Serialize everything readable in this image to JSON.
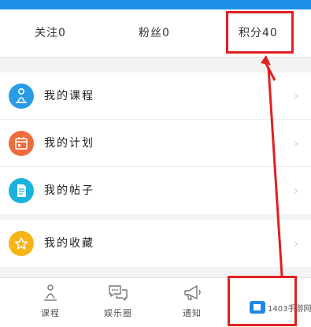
{
  "stats": {
    "follow": "关注0",
    "fans": "粉丝0",
    "points": "积分40"
  },
  "menu": {
    "items": [
      {
        "label": "我的课程",
        "icon": "meditation-icon",
        "color": "#2a9be5"
      },
      {
        "label": "我的计划",
        "icon": "calendar-icon",
        "color": "#ef6c3c"
      },
      {
        "label": "我的帖子",
        "icon": "document-icon",
        "color": "#19b3dd"
      },
      {
        "label": "我的收藏",
        "icon": "star-icon",
        "color": "#f7b417"
      }
    ]
  },
  "tabbar": {
    "tabs": [
      {
        "label": "课程",
        "icon": "meditation-tab-icon"
      },
      {
        "label": "娱乐圈",
        "icon": "chat-bubbles-icon"
      },
      {
        "label": "通知",
        "icon": "megaphone-icon"
      }
    ]
  },
  "watermark": {
    "text": "1403手游网"
  },
  "colors": {
    "header": "#1f8ee8",
    "highlight": "#e02020"
  }
}
